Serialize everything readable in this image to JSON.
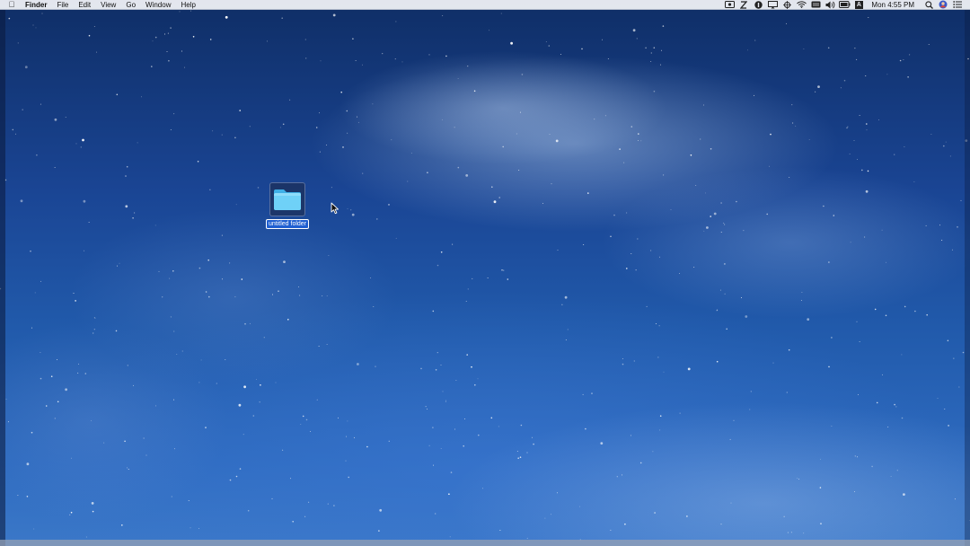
{
  "menubar": {
    "apple_icon": "apple-icon",
    "app_name": "Finder",
    "items": [
      "File",
      "Edit",
      "View",
      "Go",
      "Window",
      "Help"
    ],
    "status_icons": [
      "screen-record-icon",
      "zap-icon",
      "1password-icon",
      "airplay-display-icon",
      "crosshair-icon",
      "wifi-icon",
      "keyboard-icon",
      "volume-icon",
      "battery-icon",
      "input-source-icon"
    ],
    "input_source_letter": "A",
    "clock": "Mon 4:55 PM",
    "right_icons": [
      "spotlight-search-icon",
      "user-avatar-icon",
      "notification-center-icon"
    ]
  },
  "desktop": {
    "folder": {
      "label": "untitled folder",
      "selected": true
    }
  },
  "colors": {
    "menubar_bg": "#eceef4",
    "selection_blue": "#1f5fd1",
    "folder_blue": "#5fc8f2"
  }
}
